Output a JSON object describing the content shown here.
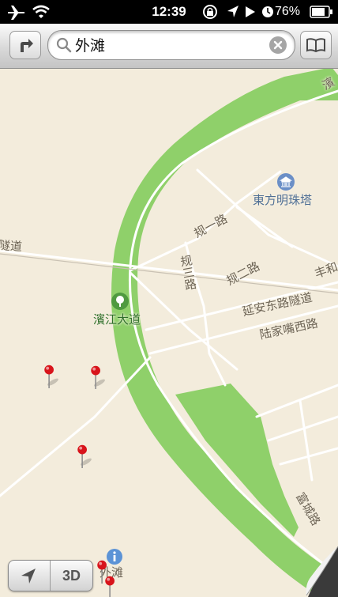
{
  "status_bar": {
    "time": "12:39",
    "battery_percent": "76%"
  },
  "toolbar": {
    "search_value": "外滩"
  },
  "map": {
    "labels": {
      "oriental_pearl_tower": "東方明珠塔",
      "binjiang_avenue": "濱江大道",
      "guiyi_road": "规一路",
      "guisan_road": "规三路",
      "guier_road": "规二路",
      "yanan_tunnel": "延安东路隧道",
      "lujiazui_west_road": "陆家嘴西路",
      "fucheng_road": "富城路",
      "tunnel_fragment": "隧道",
      "fenghe_fragment": "丰和",
      "bin_fragment": "濱",
      "bund_label": "外滩"
    },
    "pins": [
      {
        "color": "#d8141b"
      },
      {
        "color": "#d8141b"
      },
      {
        "color": "#d8141b"
      },
      {
        "color": "#d8141b"
      },
      {
        "color": "#d8141b"
      }
    ],
    "colors": {
      "land": "#f3ecdc",
      "park": "#8fd06a",
      "road": "#ffffff"
    }
  },
  "controls": {
    "three_d_label": "3D"
  }
}
